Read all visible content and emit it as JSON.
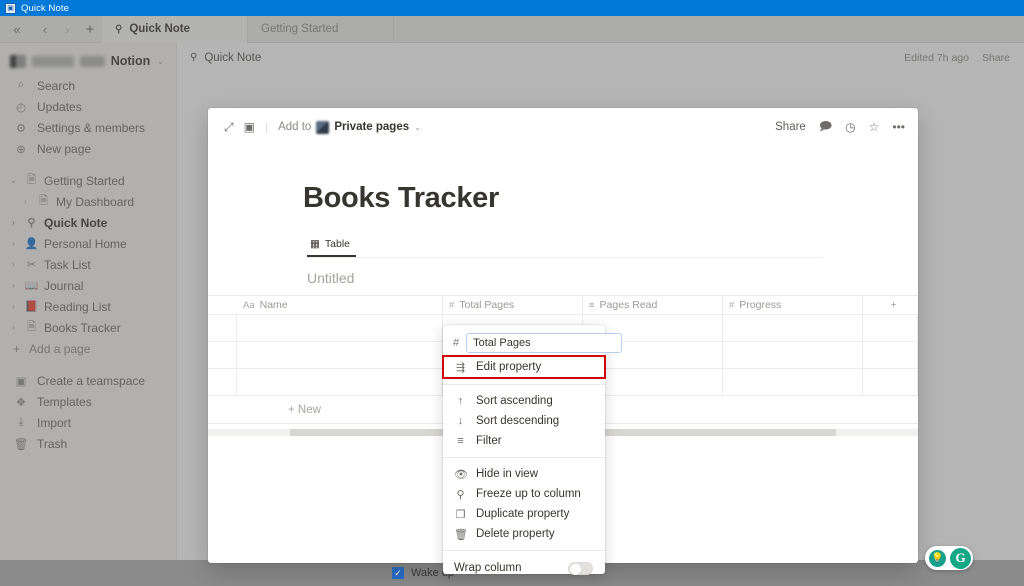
{
  "titlebar": {
    "title": "Quick Note",
    "icon": "window-icon"
  },
  "tabstrip": {
    "collapse_icon": "«",
    "back_icon": "‹",
    "forward_icon": "›",
    "new_tab_icon": "+",
    "tabs": [
      {
        "label": "Quick Note",
        "icon": "pin-icon",
        "active": true
      },
      {
        "label": "Getting Started",
        "icon": "",
        "active": false
      }
    ]
  },
  "sidebar": {
    "workspace": {
      "name": "Notion",
      "caret": "⌄"
    },
    "nav": [
      {
        "label": "Search",
        "icon": "search-icon",
        "glyph": "⌕"
      },
      {
        "label": "Updates",
        "icon": "clock-icon",
        "glyph": "◴"
      },
      {
        "label": "Settings & members",
        "icon": "gear-icon",
        "glyph": "⚙"
      },
      {
        "label": "New page",
        "icon": "plus-circle-icon",
        "glyph": "⊕"
      }
    ],
    "pages": [
      {
        "label": "Getting Started",
        "twisty": "⌄",
        "glyph": "🗎",
        "indent": false,
        "selected": false
      },
      {
        "label": "My Dashboard",
        "twisty": "›",
        "glyph": "🗎",
        "indent": true,
        "selected": false
      },
      {
        "label": "Quick Note",
        "twisty": "›",
        "glyph": "⚲",
        "indent": false,
        "selected": true
      },
      {
        "label": "Personal Home",
        "twisty": "›",
        "glyph": "👤",
        "indent": false,
        "selected": false
      },
      {
        "label": "Task List",
        "twisty": "›",
        "glyph": "✂",
        "indent": false,
        "selected": false
      },
      {
        "label": "Journal",
        "twisty": "›",
        "glyph": "📖",
        "indent": false,
        "selected": false
      },
      {
        "label": "Reading List",
        "twisty": "›",
        "glyph": "📕",
        "indent": false,
        "selected": false
      },
      {
        "label": "Books Tracker",
        "twisty": "›",
        "glyph": "🗎",
        "indent": false,
        "selected": false
      }
    ],
    "add_page": {
      "label": "Add a page",
      "glyph": "+"
    },
    "bottom": [
      {
        "label": "Create a teamspace",
        "icon": "teamspace-icon",
        "glyph": "▣"
      },
      {
        "label": "Templates",
        "icon": "templates-icon",
        "glyph": "❖"
      },
      {
        "label": "Import",
        "icon": "import-icon",
        "glyph": "⤓"
      },
      {
        "label": "Trash",
        "icon": "trash-icon",
        "glyph": "🗑"
      }
    ]
  },
  "page_topbar": {
    "breadcrumb": "Quick Note",
    "breadcrumb_icon": "pin-icon",
    "edited": "Edited 7h ago",
    "share": "Share"
  },
  "dialog": {
    "header": {
      "expand_icon": "expand-icon",
      "fullpage_icon": "open-full-page-icon",
      "add_to_label": "Add to",
      "destination": "Private pages",
      "destination_caret": "⌄",
      "share": "Share",
      "comment_icon": "comment-icon",
      "history_icon": "history-icon",
      "favorite_icon": "star-icon",
      "more_icon": "more-options-icon"
    },
    "title": "Books Tracker",
    "view_tab": {
      "label": "Table",
      "icon": "table-icon"
    },
    "db_title": "Untitled",
    "table": {
      "columns": [
        {
          "label": "Name",
          "type_glyph": "Aa"
        },
        {
          "label": "Total Pages",
          "type_glyph": "#"
        },
        {
          "label": "Pages Read",
          "type_glyph": "≡"
        },
        {
          "label": "Progress",
          "type_glyph": "#"
        }
      ],
      "add_column_icon": "+",
      "rows": [
        [
          "",
          "",
          "",
          ""
        ],
        [
          "",
          "",
          "",
          ""
        ],
        [
          "",
          "",
          "",
          ""
        ]
      ],
      "new_row_label": "New",
      "new_row_icon": "+"
    }
  },
  "context_menu": {
    "property_name_value": "Total Pages",
    "property_type_glyph": "#",
    "items": [
      {
        "label": "Edit property",
        "glyph": "⇶",
        "icon": "sliders-icon",
        "highlighted": true
      },
      {
        "label": "Sort ascending",
        "glyph": "↑",
        "icon": "arrow-up-icon",
        "highlighted": false
      },
      {
        "label": "Sort descending",
        "glyph": "↓",
        "icon": "arrow-down-icon",
        "highlighted": false
      },
      {
        "label": "Filter",
        "glyph": "≡",
        "icon": "filter-icon",
        "highlighted": false
      },
      {
        "label": "Hide in view",
        "glyph": "👁",
        "icon": "eye-off-icon",
        "highlighted": false
      },
      {
        "label": "Freeze up to column",
        "glyph": "⚲",
        "icon": "pin-icon",
        "highlighted": false
      },
      {
        "label": "Duplicate property",
        "glyph": "❐",
        "icon": "duplicate-icon",
        "highlighted": false
      },
      {
        "label": "Delete property",
        "glyph": "🗑",
        "icon": "trash-icon",
        "highlighted": false
      }
    ],
    "wrap_column": {
      "label": "Wrap column",
      "enabled": false
    },
    "highlight_color": "#cf0a0a"
  },
  "grammarly": {
    "bulb_icon": "lightbulb-icon",
    "logo": "G"
  },
  "os_bottom": {
    "wake_up_label": "Wake up",
    "wake_up_checked": true
  }
}
